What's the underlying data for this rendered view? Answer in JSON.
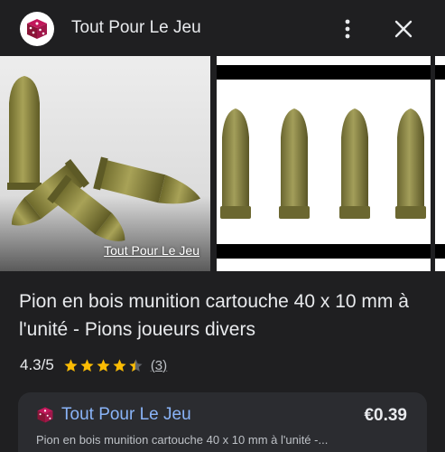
{
  "header": {
    "site_name": "Tout Pour Le Jeu",
    "logo_icon": "dice-icon",
    "more_icon": "more-vert-icon",
    "close_icon": "close-icon"
  },
  "gallery": {
    "image1_caption": "Tout Pour Le Jeu"
  },
  "product": {
    "title": "Pion en bois munition cartouche 40 x 10 mm à l'unité - Pions joueurs divers",
    "rating": "4.3/5",
    "stars": 4.3,
    "review_count": "(3)"
  },
  "offer": {
    "seller": "Tout Pour Le Jeu",
    "price": "€0.39",
    "description": "Pion en bois munition cartouche 40 x 10 mm à l'unité -..."
  },
  "colors": {
    "background": "#1f1f21",
    "card": "#2b2c30",
    "link": "#8ab4f8",
    "star": "#fbbc04",
    "dice": "#8a1538"
  }
}
